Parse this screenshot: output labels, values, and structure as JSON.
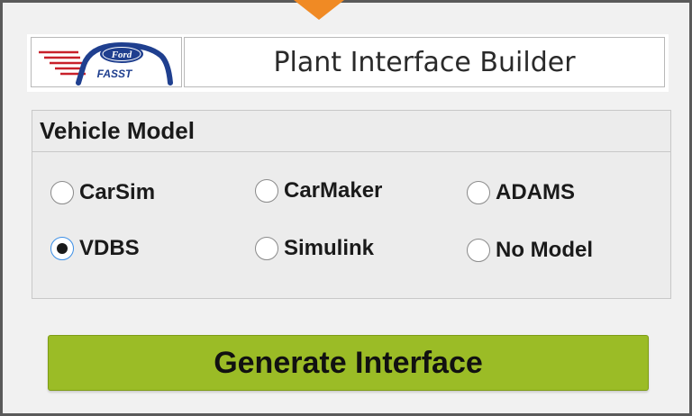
{
  "header": {
    "title": "Plant Interface Builder",
    "logo_text": "Ford",
    "logo_subtext": "FASST"
  },
  "vehicle_model": {
    "title": "Vehicle Model",
    "options": [
      {
        "label": "CarSim",
        "checked": false
      },
      {
        "label": "CarMaker",
        "checked": false
      },
      {
        "label": "ADAMS",
        "checked": false
      },
      {
        "label": "VDBS",
        "checked": true
      },
      {
        "label": "Simulink",
        "checked": false
      },
      {
        "label": "No Model",
        "checked": false
      }
    ]
  },
  "actions": {
    "generate_label": "Generate Interface"
  },
  "colors": {
    "generate_button": "#9bbc26",
    "pointer": "#f08a24",
    "logo_blue": "#1f3f8f",
    "logo_red": "#c8202a"
  }
}
